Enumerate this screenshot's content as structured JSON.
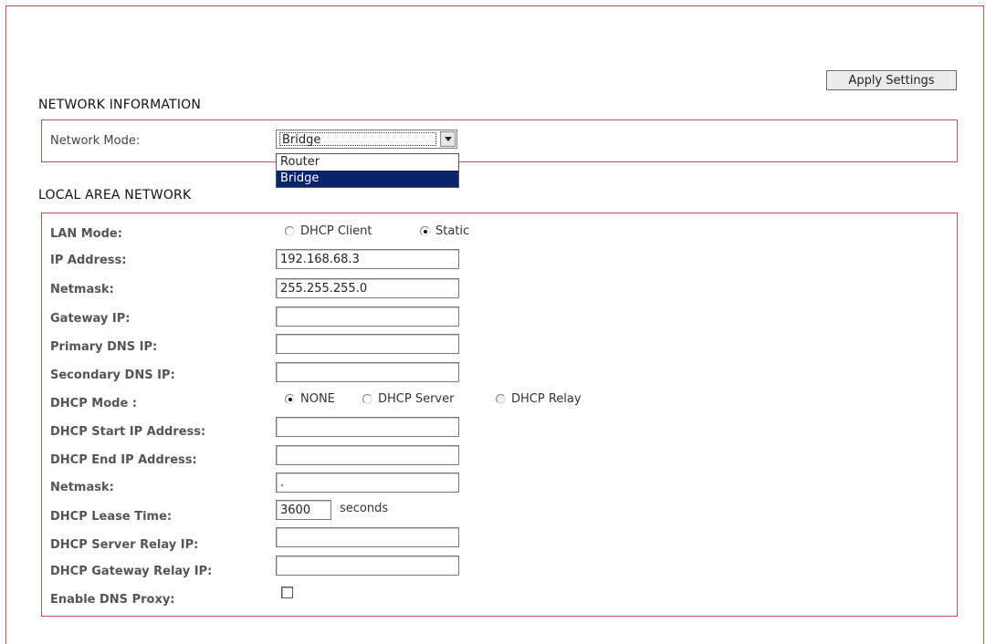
{
  "toolbar": {
    "apply_label": "Apply Settings"
  },
  "network_information": {
    "title": "NETWORK INFORMATION",
    "network_mode_label": "Network Mode:",
    "network_mode_value": "Bridge",
    "options": [
      "Router",
      "Bridge"
    ],
    "selected_option": "Bridge"
  },
  "lan": {
    "title": "LOCAL AREA NETWORK",
    "lan_mode_label": "LAN Mode:",
    "lan_mode_options": [
      "DHCP Client",
      "Static"
    ],
    "lan_mode_selected": "Static",
    "ip_address_label": "IP Address:",
    "ip_address_value": "192.168.68.3",
    "netmask_label": "Netmask:",
    "netmask_value": "255.255.255.0",
    "gateway_label": "Gateway IP:",
    "gateway_value": "",
    "primary_dns_label": "Primary DNS IP:",
    "primary_dns_value": "",
    "secondary_dns_label": "Secondary DNS IP:",
    "secondary_dns_value": "",
    "dhcp_mode_label": "DHCP Mode :",
    "dhcp_mode_options": [
      "NONE",
      "DHCP Server",
      "DHCP Relay"
    ],
    "dhcp_mode_selected": "NONE",
    "dhcp_start_label": "DHCP Start IP Address:",
    "dhcp_start_value": "",
    "dhcp_end_label": "DHCP End IP Address:",
    "dhcp_end_value": "",
    "dhcp_netmask_label": "Netmask:",
    "dhcp_netmask_value": ".",
    "lease_time_label": "DHCP Lease Time:",
    "lease_time_value": "3600",
    "lease_time_unit": "seconds",
    "server_relay_label": "DHCP Server Relay IP:",
    "server_relay_value": "",
    "gateway_relay_label": "DHCP Gateway Relay IP:",
    "gateway_relay_value": "",
    "dns_proxy_label": "Enable DNS Proxy:",
    "dns_proxy_checked": false
  }
}
